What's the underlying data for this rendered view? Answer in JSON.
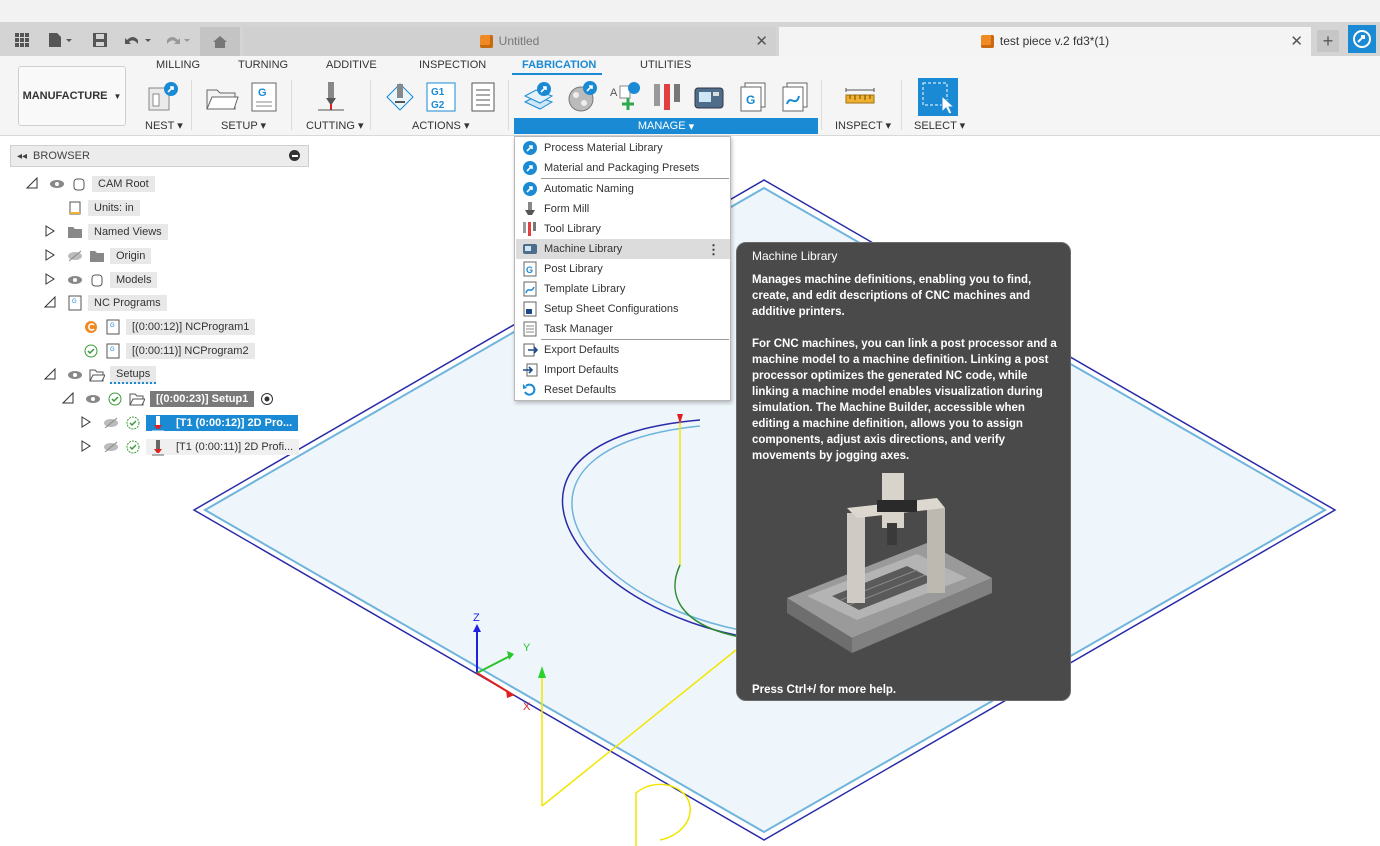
{
  "app": {
    "tabs": [
      {
        "label": "Untitled"
      },
      {
        "label": "test piece v.2 fd3*(1)"
      }
    ]
  },
  "ribbon": {
    "workspace": "MANUFACTURE",
    "tabs": [
      "MILLING",
      "TURNING",
      "ADDITIVE",
      "INSPECTION",
      "FABRICATION",
      "UTILITIES"
    ],
    "active_tab": "FABRICATION",
    "groups": {
      "nest": "NEST",
      "setup": "SETUP",
      "cutting": "CUTTING",
      "actions": "ACTIONS",
      "manage": "MANAGE",
      "inspect": "INSPECT",
      "select": "SELECT"
    }
  },
  "browser": {
    "title": "BROWSER",
    "nodes": {
      "cam_root": "CAM Root",
      "units": "Units: in",
      "named_views": "Named Views",
      "origin": "Origin",
      "models": "Models",
      "nc_programs": "NC Programs",
      "nc1": "[(0:00:12)] NCProgram1",
      "nc2": "[(0:00:11)] NCProgram2",
      "setups": "Setups",
      "setup1": "[(0:00:23)] Setup1",
      "op1": "[T1 (0:00:12)] 2D Pro...",
      "op2": "[T1 (0:00:11)] 2D Profi..."
    }
  },
  "manage_menu": {
    "items": [
      {
        "label": "Process Material Library",
        "icon": "autodesk-logo-icon"
      },
      {
        "label": "Material and Packaging Presets",
        "icon": "autodesk-logo-icon"
      },
      {
        "label": "Automatic Naming",
        "icon": "autodesk-logo-icon"
      },
      {
        "label": "Form Mill",
        "icon": "form-mill-icon"
      },
      {
        "label": "Tool Library",
        "icon": "tool-library-icon"
      },
      {
        "label": "Machine Library",
        "icon": "machine-icon"
      },
      {
        "label": "Post Library",
        "icon": "post-library-icon"
      },
      {
        "label": "Template Library",
        "icon": "template-icon"
      },
      {
        "label": "Setup Sheet Configurations",
        "icon": "setup-sheet-icon"
      },
      {
        "label": "Task Manager",
        "icon": "task-manager-icon"
      },
      {
        "label": "Export Defaults",
        "icon": "export-icon"
      },
      {
        "label": "Import Defaults",
        "icon": "import-icon"
      },
      {
        "label": "Reset Defaults",
        "icon": "reset-icon"
      }
    ],
    "highlighted": "Machine Library"
  },
  "tooltip": {
    "title": "Machine Library",
    "p1": "Manages machine definitions, enabling you to find, create, and edit descriptions of CNC machines and additive printers.",
    "p2": "For CNC machines, you can link a post processor and a machine model to a machine definition. Linking a post processor optimizes the generated NC code, while linking a machine model enables visualization during simulation. The Machine Builder, accessible when editing a machine definition, allows you to assign components, adjust axis directions, and verify movements by jogging axes.",
    "footer": "Press Ctrl+/ for more help."
  },
  "viewport": {
    "axis_x": "X",
    "axis_y": "Y",
    "axis_z": "Z"
  },
  "colors": {
    "accent": "#1a8ad4",
    "tooltip_bg": "#4a4a4a",
    "stock_fill": "#eef6fb",
    "toolpath_yellow": "#f2e600",
    "toolpath_green": "#2e8b2e"
  }
}
